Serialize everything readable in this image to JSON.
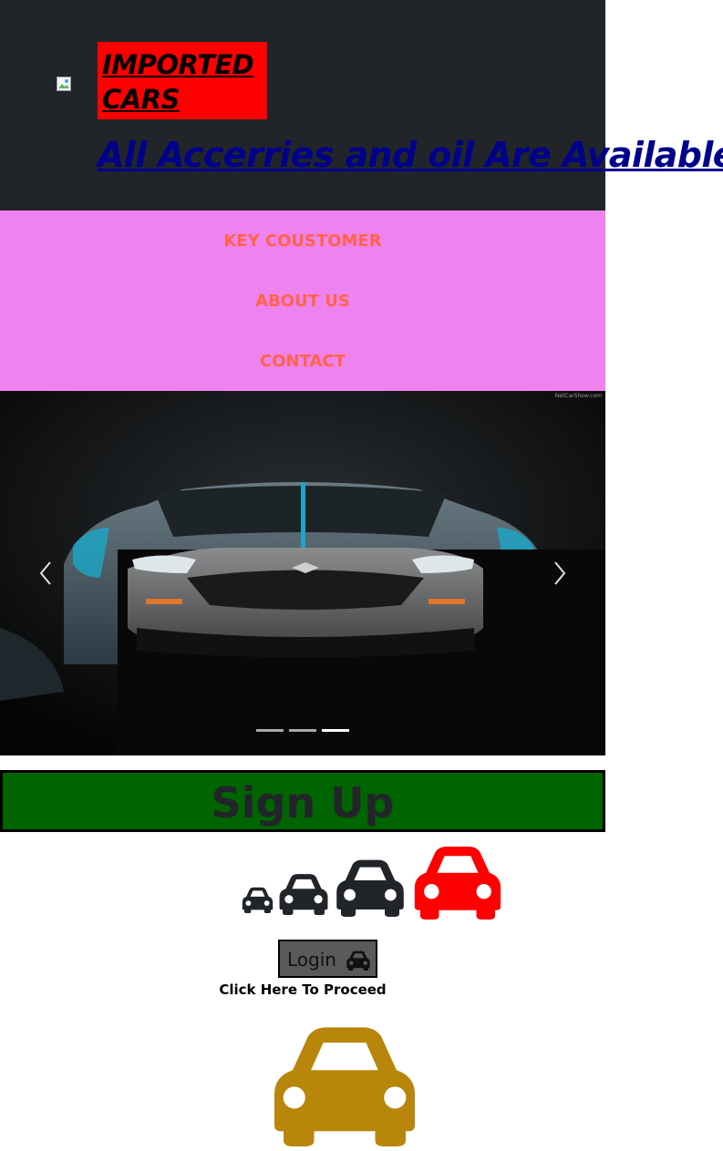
{
  "header": {
    "logo_text": "IMPORTED CARS",
    "tagline": "All Accerries and oil Are Available",
    "background_color": "#212529",
    "logo_background_color": "#ff0000",
    "tagline_color": "#00008b"
  },
  "nav": {
    "background_color": "#ee82ee",
    "text_color": "#ff6347",
    "items": [
      {
        "label": "KEY COUSTOMER"
      },
      {
        "label": "ABOUT US"
      },
      {
        "label": "CONTACT"
      }
    ]
  },
  "carousel": {
    "credit": "NetCarShow.com",
    "prev_icon": "chevron-left-icon",
    "next_icon": "chevron-right-icon",
    "slide_count": 3,
    "active_index": 2
  },
  "signup": {
    "label": "Sign Up",
    "background_color": "#006400"
  },
  "car_icons": {
    "icon": "car-icon",
    "colors": [
      "#212529",
      "#212529",
      "#212529",
      "#ff0000"
    ]
  },
  "login": {
    "label": "Login",
    "icon": "car-icon",
    "hint": "Click Here To Proceed"
  },
  "big_car": {
    "icon": "car-icon",
    "color": "#b8860b"
  }
}
